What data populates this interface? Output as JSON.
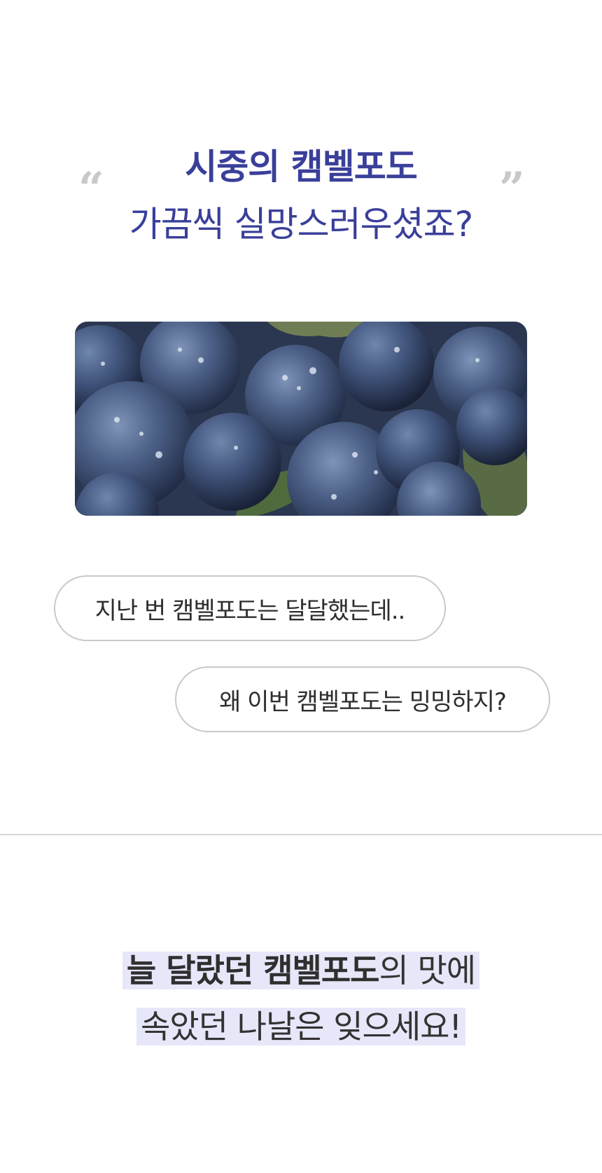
{
  "header": {
    "line1": "시중의 캠벨포도",
    "line2": "가끔씩 실망스러우셨죠?",
    "open_quote": "“",
    "close_quote": "”"
  },
  "image": {
    "subject": "grapes-photo"
  },
  "bubbles": [
    {
      "text": "지난 번 캠벨포도는 달달했는데.."
    },
    {
      "text": "왜 이번 캠벨포도는 밍밍하지?"
    }
  ],
  "tagline": {
    "line1_bold": "늘 달랐던 캠벨포도",
    "line1_rest": "의 맛에",
    "line2": "속았던 나날은 잊으세요!"
  },
  "colors": {
    "accent": "#3a3f9a",
    "highlight": "#e7e7fa",
    "border": "#c9c9c9"
  }
}
